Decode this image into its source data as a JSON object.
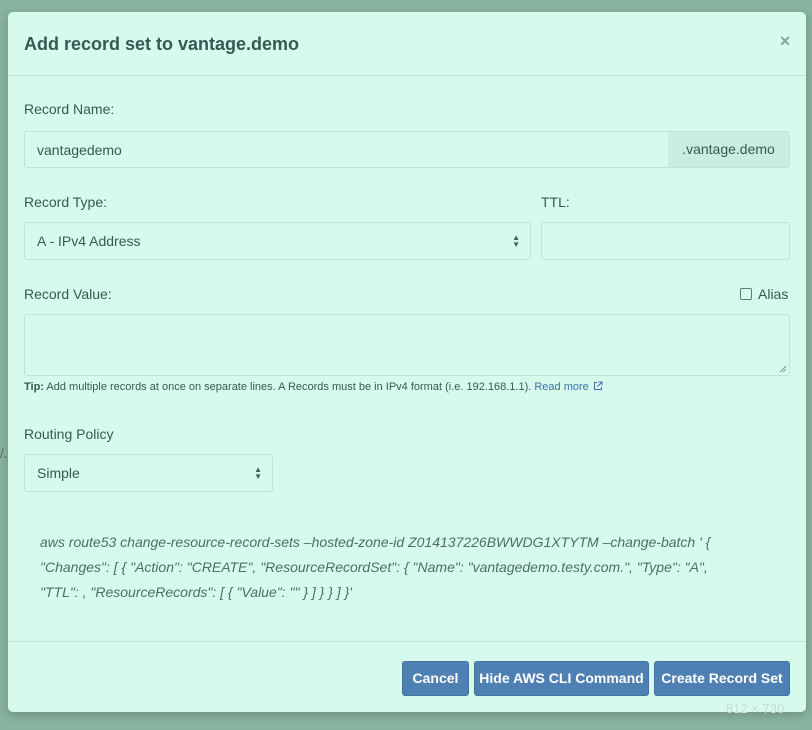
{
  "modal": {
    "title": "Add record set to vantage.demo",
    "close_glyph": "×"
  },
  "form": {
    "record_name_label": "Record Name:",
    "record_name_value": "vantagedemo",
    "record_name_suffix": ".vantage.demo",
    "record_type_label": "Record Type:",
    "record_type_selected": "A - IPv4 Address",
    "ttl_label": "TTL:",
    "ttl_value": "",
    "record_value_label": "Record Value:",
    "record_value_value": "",
    "alias_label": "Alias",
    "alias_checked": false,
    "tip_prefix": "Tip:",
    "tip_text": " Add multiple records at once on separate lines. A Records must be in IPv4 format (i.e. 192.168.1.1). ",
    "tip_link": "Read more",
    "routing_policy_label": "Routing Policy",
    "routing_policy_selected": "Simple"
  },
  "cli_command": {
    "line1": "aws route53 change-resource-record-sets –hosted-zone-id Z014137226BWWDG1XTYTM –change-batch ' {",
    "line2": "\"Changes\": [ { \"Action\": \"CREATE\", \"ResourceRecordSet\": { \"Name\": \"vantagedemo.testy.com.\", \"Type\": \"A\",",
    "line3": "\"TTL\": , \"ResourceRecords\": [ { \"Value\": \"\" } ] } } ] }'"
  },
  "footer": {
    "cancel_label": "Cancel",
    "hide_cli_label": "Hide AWS CLI Command",
    "create_label": "Create Record Set"
  },
  "overlay": {
    "size_label": "812 × 730"
  },
  "backdrop": {
    "glyph": "/."
  },
  "colors": {
    "modal_bg": "#d6fbed",
    "button_primary": "#4f80b4",
    "link": "#3d6fa5"
  },
  "icons": {
    "close": "close-icon",
    "select": "select-arrows-icon",
    "external_link": "external-link-icon"
  }
}
